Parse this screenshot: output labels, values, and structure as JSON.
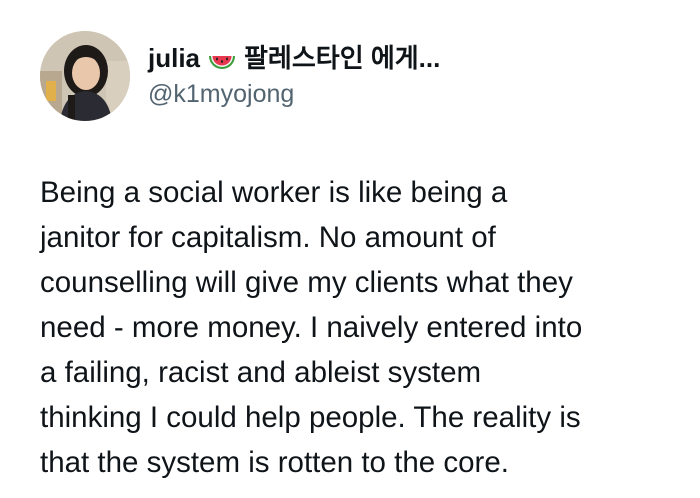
{
  "tweet": {
    "author": {
      "display_name": "julia",
      "name_suffix": "팔레스타인 에게...",
      "handle": "@k1myojong",
      "emoji": "watermelon-icon",
      "avatar": "avatar"
    },
    "body_lines": [
      "Being a social worker is like being a",
      "janitor for capitalism. No amount of",
      "counselling will give my clients what they",
      "need - more money. I naively entered into",
      "a failing, racist and ableist system",
      "thinking I could help people. The reality is",
      "that the system is rotten to the core."
    ]
  },
  "colors": {
    "text": "#0f1419",
    "handle": "#536471",
    "background": "#ffffff",
    "watermelon_red": "#e8384f",
    "watermelon_green": "#3a9d3a"
  }
}
